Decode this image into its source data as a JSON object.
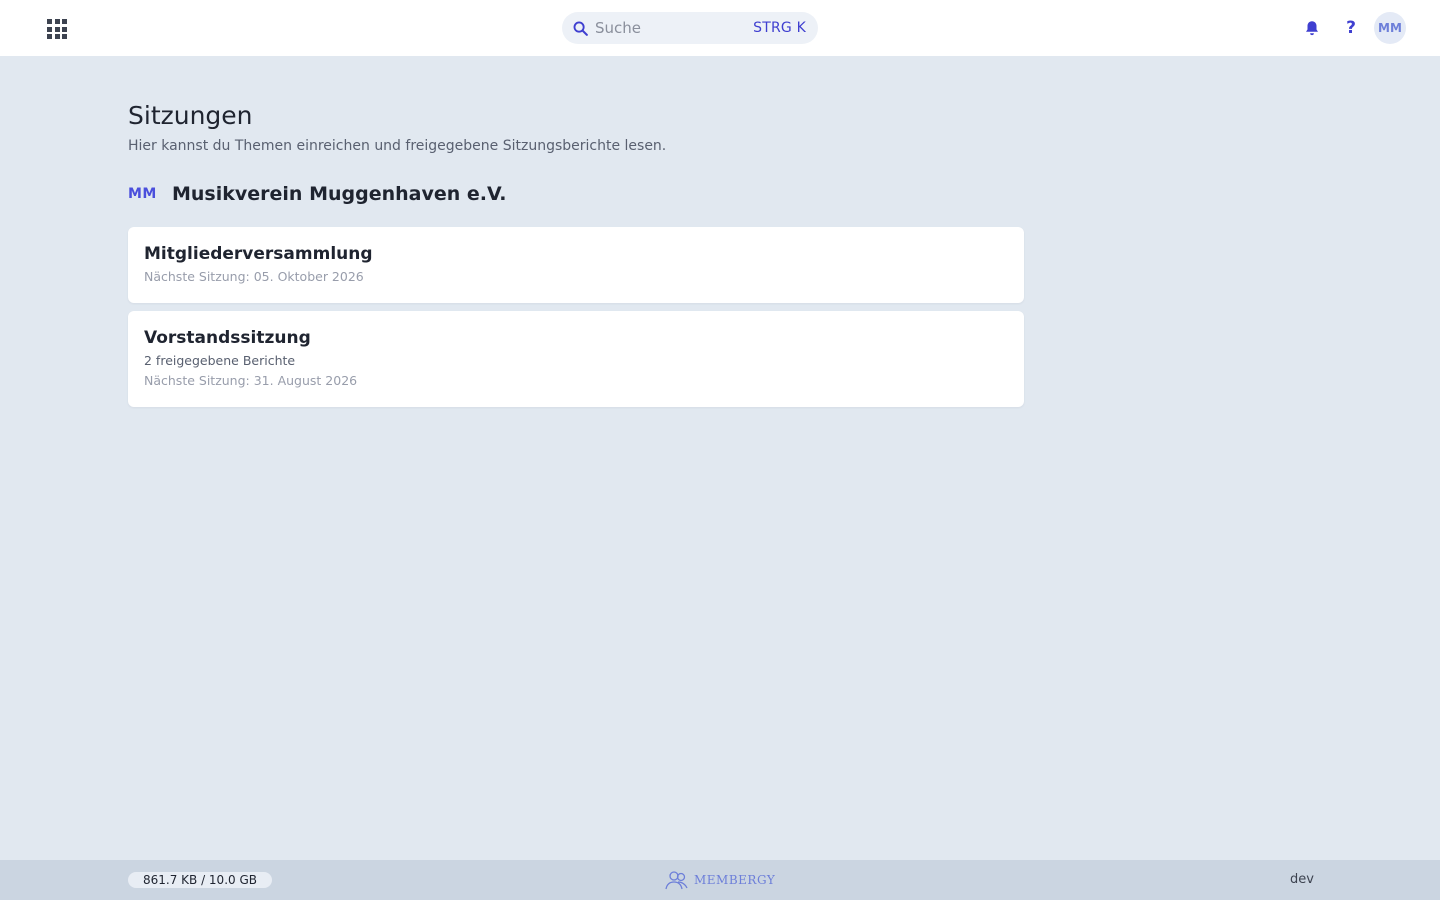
{
  "header": {
    "search_placeholder": "Suche",
    "search_shortcut": "STRG K",
    "avatar_initials": "MM",
    "help_label": "?"
  },
  "main": {
    "title": "Sitzungen",
    "subtitle": "Hier kannst du Themen einreichen und freigegebene Sitzungsberichte lesen.",
    "org": {
      "logo": "MM",
      "name": "Musikverein Muggenhaven e.V."
    },
    "sessions": [
      {
        "title": "Mitgliederversammlung",
        "reports": "",
        "next": "Nächste Sitzung: 05. Oktober 2026"
      },
      {
        "title": "Vorstandssitzung",
        "reports": "2 freigegebene Berichte",
        "next": "Nächste Sitzung: 31. August 2026"
      }
    ]
  },
  "footer": {
    "storage": "861.7 KB / 10.0 GB",
    "brand": "MEMBERGY",
    "env": "dev"
  },
  "colors": {
    "accent": "#3f3fd0",
    "background": "#e1e8f0",
    "footer": "#cbd5e1"
  },
  "icons": [
    "apps-grid-icon",
    "search-icon",
    "bell-icon",
    "membergy-logo-icon"
  ]
}
